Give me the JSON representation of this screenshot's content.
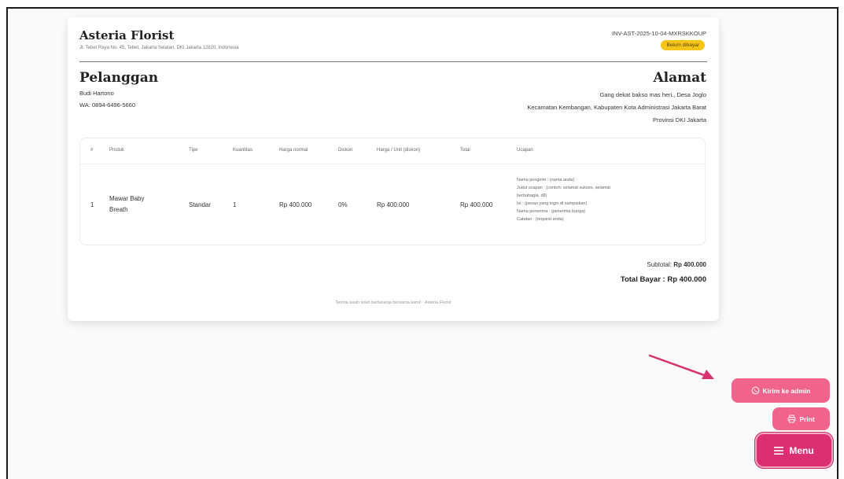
{
  "header": {
    "shop_name": "Asteria Florist",
    "shop_address": "Jl. Tebet Raya No. 45, Tebet, Jakarta Selatan, DKI Jakarta 12820, Indonesia",
    "invoice_number": "INV-AST-2025-10-04-MXRSKKOUP",
    "status": "Belum dibayar"
  },
  "customer": {
    "title": "Pelanggan",
    "name": "Budi Hartono",
    "whatsapp": "WA: 0894-6496-5660"
  },
  "address": {
    "title": "Alamat",
    "line1": "Gang dekat bakso mas heri., Desa Joglo",
    "line2": "Kecamatan Kembangan, Kabupaten Kota Administrasi Jakarta Barat",
    "line3": "Provinsi DKI Jakarta"
  },
  "table": {
    "headers": [
      "#",
      "Produk",
      "Tipe",
      "Kuantitas",
      "Harga normal",
      "Diskon",
      "Harga / Unit (diskon)",
      "Total",
      "Ucapan"
    ],
    "row": {
      "no": "1",
      "product_line1": "Mawar Baby",
      "product_line2": "Breath",
      "type": "Standar",
      "qty": "1",
      "normal_price": "Rp 400.000",
      "discount": "0%",
      "unit_price": "Rp 400.000",
      "total": "Rp 400.000",
      "note_lines": [
        "Nama pengirim : (nama anda)",
        "Judul ucapan : (contoh: selamat sukses, selamat",
        "berbahagia, dll)",
        "Isi : (pesan yang ingin di sampaikan)",
        "Nama penerima : (penerima bunga)",
        "Catatan : (request anda)"
      ]
    }
  },
  "summary": {
    "subtotal_label": "Subtotal:",
    "subtotal_value": "Rp 400.000",
    "total_label": "Total Bayar :",
    "total_value": "Rp 400.000"
  },
  "footer_note": "Terima kasih telah berbelanja bersama kami! - Asteria Florist",
  "actions": {
    "kirim_label": "Kirim ke admin",
    "print_label": "Print",
    "menu_label": "Menu"
  },
  "colors": {
    "accent_pink": "#f0648c",
    "menu_pink": "#dc2e72",
    "badge_yellow": "#f5c518"
  }
}
